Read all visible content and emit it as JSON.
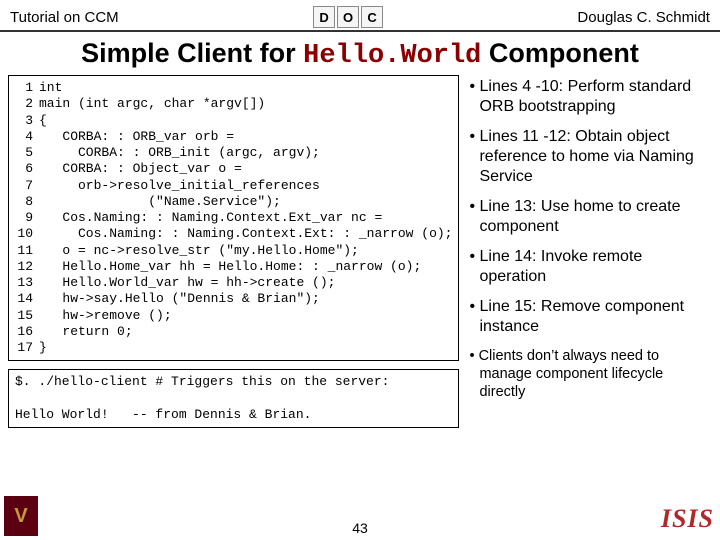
{
  "header": {
    "left": "Tutorial on CCM",
    "right": "Douglas C. Schmidt",
    "logo_letters": [
      "D",
      "O",
      "C"
    ]
  },
  "title_prefix": "Simple Client for ",
  "title_mono": "Hello.World",
  "title_suffix": " Component",
  "code_lines": [
    "int",
    "main (int argc, char *argv[])",
    "{",
    "   CORBA: : ORB_var orb =",
    "     CORBA: : ORB_init (argc, argv);",
    "   CORBA: : Object_var o =",
    "     orb->resolve_initial_references",
    "              (\"Name.Service\");",
    "   Cos.Naming: : Naming.Context.Ext_var nc =",
    "     Cos.Naming: : Naming.Context.Ext: : _narrow (o);",
    "   o = nc->resolve_str (\"my.Hello.Home\");",
    "   Hello.Home_var hh = Hello.Home: : _narrow (o);",
    "   Hello.World_var hw = hh->create ();",
    "   hw->say.Hello (\"Dennis & Brian\");",
    "   hw->remove ();",
    "   return 0;",
    "}"
  ],
  "terminal": {
    "line1": "$. ./hello-client # Triggers this on the server:",
    "line2": "Hello World!   -- from Dennis & Brian."
  },
  "bullets": [
    {
      "text": "Lines 4 -10: Perform standard ORB bootstrapping"
    },
    {
      "text": "Lines 11 -12: Obtain object reference to home via Naming Service"
    },
    {
      "text": "Line 13: Use home to create component"
    },
    {
      "text": "Line 14: Invoke remote operation"
    },
    {
      "text": "Line 15: Remove component instance"
    }
  ],
  "subbullet": "Clients don’t always need to manage component lifecycle directly",
  "page_number": "43",
  "footer_badge": "V",
  "footer_right": "ISIS"
}
